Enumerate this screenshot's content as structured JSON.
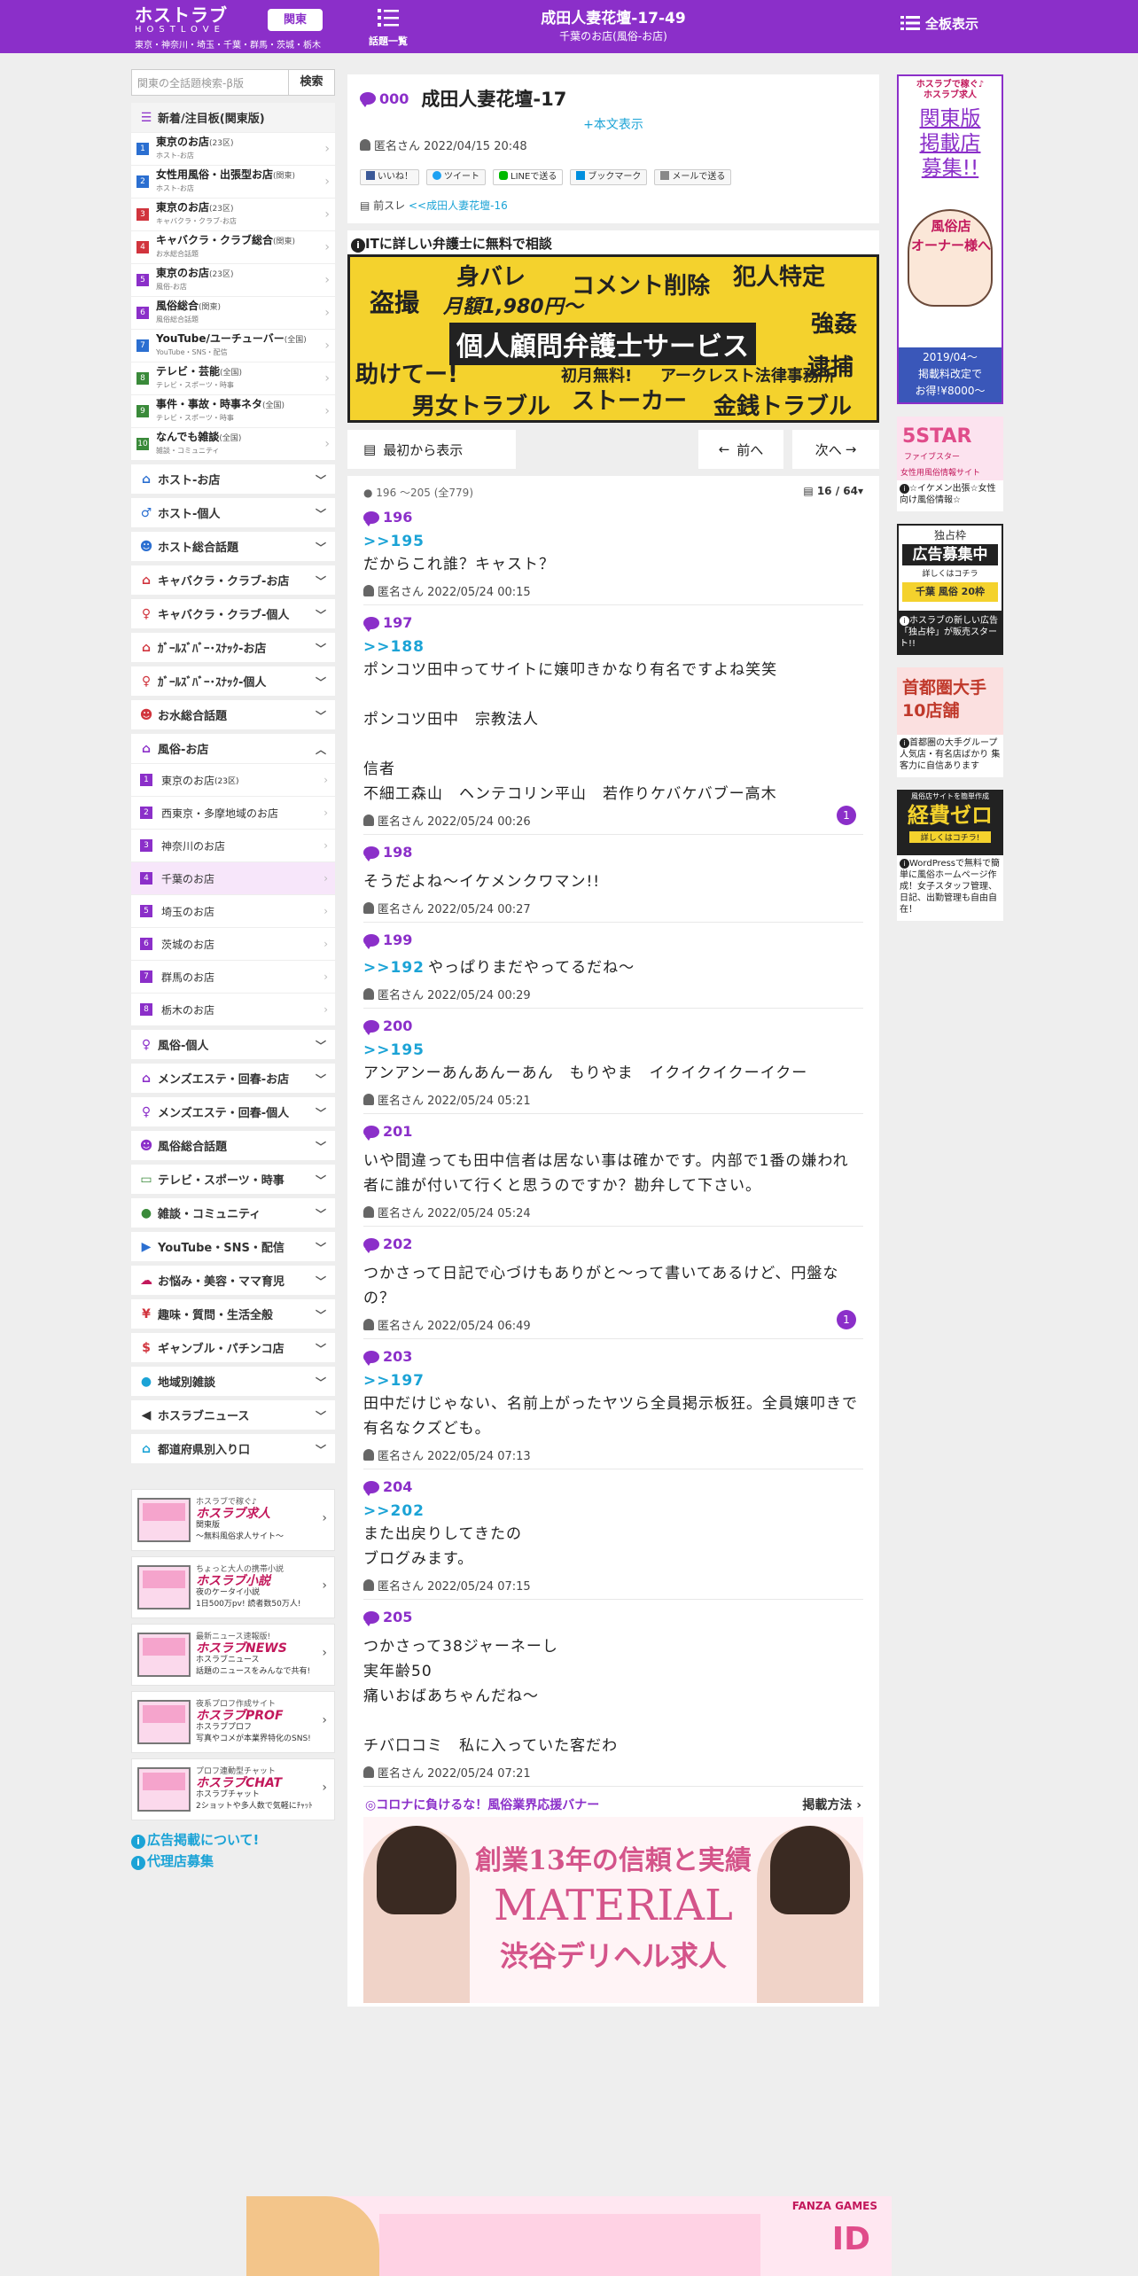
{
  "header": {
    "logo_main": "ホストラブ",
    "logo_sub": "HOSTLOVE",
    "region_button": "関東",
    "region_list": "東京・神奈川・埼玉・千葉・群馬・茨城・栃木",
    "topics_label": "話題一覧",
    "thread_title": "成田人妻花壇-17-49",
    "thread_subtitle": "千葉のお店(風俗-お店)",
    "all_boards_label": "全板表示"
  },
  "sidebar": {
    "search_placeholder": "関東の全話題検索-β版",
    "search_button": "検索",
    "new_boards_title": "新着/注目板(関東版)",
    "new_boards": [
      {
        "num": "1",
        "color": "#2b6fd1",
        "label": "東京のお店",
        "small": "(23区)",
        "sub": "ホスト-お店"
      },
      {
        "num": "2",
        "color": "#2b6fd1",
        "label": "女性用風俗・出張型お店",
        "small": "(関東)",
        "sub": "ホスト-お店"
      },
      {
        "num": "3",
        "color": "#d1343d",
        "label": "東京のお店",
        "small": "(23区)",
        "sub": "キャバクラ・クラブ-お店"
      },
      {
        "num": "4",
        "color": "#d1343d",
        "label": "キャバクラ・クラブ総合",
        "small": "(関東)",
        "sub": "お水総合話題"
      },
      {
        "num": "5",
        "color": "#8b2fc9",
        "label": "東京のお店",
        "small": "(23区)",
        "sub": "風俗-お店"
      },
      {
        "num": "6",
        "color": "#8b2fc9",
        "label": "風俗総合",
        "small": "(関東)",
        "sub": "風俗総合話題"
      },
      {
        "num": "7",
        "color": "#2b6fd1",
        "label": "YouTube/ユーチューバー",
        "small": "(全国)",
        "sub": "YouTube・SNS・配信"
      },
      {
        "num": "8",
        "color": "#3a8a3a",
        "label": "テレビ・芸能",
        "small": "(全国)",
        "sub": "テレビ・スポーツ・時事"
      },
      {
        "num": "9",
        "color": "#3a8a3a",
        "label": "事件・事故・時事ネタ",
        "small": "(全国)",
        "sub": "テレビ・スポーツ・時事"
      },
      {
        "num": "10",
        "color": "#3a8a3a",
        "label": "なんでも雑談",
        "small": "(全国)",
        "sub": "雑談・コミュニティ"
      }
    ],
    "categories_a": [
      {
        "icon": "home-icon",
        "glyph": "⌂",
        "color": "#2b6fd1",
        "label": "ホスト-お店"
      },
      {
        "icon": "person-icon",
        "glyph": "♂",
        "color": "#2b6fd1",
        "label": "ホスト-個人"
      },
      {
        "icon": "group-icon",
        "glyph": "☻",
        "color": "#2b6fd1",
        "label": "ホスト総合話題"
      },
      {
        "icon": "home-icon",
        "glyph": "⌂",
        "color": "#d1343d",
        "label": "キャバクラ・クラブ-お店"
      },
      {
        "icon": "person-icon",
        "glyph": "♀",
        "color": "#d1343d",
        "label": "キャバクラ・クラブ-個人"
      },
      {
        "icon": "home-icon",
        "glyph": "⌂",
        "color": "#d1343d",
        "label": "ｶﾞｰﾙｽﾞﾊﾞｰ･ｽﾅｯｸ-お店"
      },
      {
        "icon": "person-icon",
        "glyph": "♀",
        "color": "#d1343d",
        "label": "ｶﾞｰﾙｽﾞﾊﾞｰ･ｽﾅｯｸ-個人"
      },
      {
        "icon": "group-icon",
        "glyph": "☻",
        "color": "#d1343d",
        "label": "お水総合話題"
      }
    ],
    "fuzoku_open": {
      "label": "風俗-お店",
      "icon": "home-icon"
    },
    "fuzoku_items": [
      {
        "num": "1",
        "label": "東京のお店",
        "small": "(23区)"
      },
      {
        "num": "2",
        "label": "西東京・多摩地域のお店",
        "small": ""
      },
      {
        "num": "3",
        "label": "神奈川のお店",
        "small": ""
      },
      {
        "num": "4",
        "label": "千葉のお店",
        "small": ""
      },
      {
        "num": "5",
        "label": "埼玉のお店",
        "small": ""
      },
      {
        "num": "6",
        "label": "茨城のお店",
        "small": ""
      },
      {
        "num": "7",
        "label": "群馬のお店",
        "small": ""
      },
      {
        "num": "8",
        "label": "栃木のお店",
        "small": ""
      }
    ],
    "categories_b": [
      {
        "icon": "person-icon",
        "glyph": "♀",
        "color": "#8b2fc9",
        "label": "風俗-個人"
      },
      {
        "icon": "home-icon",
        "glyph": "⌂",
        "color": "#8b2fc9",
        "label": "メンズエステ・回春-お店"
      },
      {
        "icon": "person-icon",
        "glyph": "♀",
        "color": "#8b2fc9",
        "label": "メンズエステ・回春-個人"
      },
      {
        "icon": "group-icon",
        "glyph": "☻",
        "color": "#8b2fc9",
        "label": "風俗総合話題"
      },
      {
        "icon": "tv-icon",
        "glyph": "▭",
        "color": "#3a8a3a",
        "label": "テレビ・スポーツ・時事"
      },
      {
        "icon": "chat-icon",
        "glyph": "●",
        "color": "#3a8a3a",
        "label": "雑談・コミュニティ"
      },
      {
        "icon": "youtube-icon",
        "glyph": "▶",
        "color": "#2b6fd1",
        "label": "YouTube・SNS・配信"
      },
      {
        "icon": "cloud-icon",
        "glyph": "☁",
        "color": "#c2185b",
        "label": "お悩み・美容・ママ育児"
      },
      {
        "icon": "fork-icon",
        "glyph": "¥",
        "color": "#d1343d",
        "label": "趣味・質問・生活全般"
      },
      {
        "icon": "money-icon",
        "glyph": "$",
        "color": "#d1343d",
        "label": "ギャンブル・パチンコ店"
      },
      {
        "icon": "chat-icon",
        "glyph": "●",
        "color": "#1ba3d6",
        "label": "地域別雑談"
      },
      {
        "icon": "speaker-icon",
        "glyph": "◀",
        "color": "#333333",
        "label": "ホスラブニュース"
      },
      {
        "icon": "home-icon",
        "glyph": "⌂",
        "color": "#1ba3d6",
        "label": "都道府県別入り口"
      }
    ],
    "promo_banners": [
      {
        "small": "ホスラブで稼ぐ♪",
        "main": "ホスラブ求人",
        "note": "関東版\n〜無料風俗求人サイト〜"
      },
      {
        "small": "ちょっと大人の携帯小説",
        "main": "ホスラブ小説",
        "note": "夜のケータイ小説\n1日500万pv! 読者数50万人!"
      },
      {
        "small": "最新ニュース速報版!",
        "main": "ホスラブNEWS",
        "note": "ホスラブニュース\n話題のニュースをみんなで共有!"
      },
      {
        "small": "夜系プロフ作成サイト",
        "main": "ホスラブPROF",
        "note": "ホスラブプロフ\n写真やコメが本業界特化のSNS!"
      },
      {
        "small": "プロフ連動型チャット",
        "main": "ホスラブCHAT",
        "note": "ホスラブチャット\n2ショットや多人数で気軽にﾁｬｯﾄ"
      }
    ],
    "links": [
      "広告掲載について!",
      "代理店募集"
    ]
  },
  "thread": {
    "num": "000",
    "title": "成田人妻花壇-17",
    "show_body": "+本文表示",
    "author": "匿名さん 2022/04/15 20:48",
    "shares": [
      "いいね！",
      "ツイート",
      "LINEで送る",
      "ブックマーク",
      "メールで送る"
    ],
    "prev_label": "前スレ",
    "prev_link": "<<成田人妻花壇-16"
  },
  "ad_lawyer": {
    "header": "ITに詳しい弁護士に無料で相談",
    "words": [
      "身バレ",
      "コメント削除",
      "犯人特定",
      "盗撮",
      "月額1,980円〜",
      "強姦",
      "個人顧問弁護士サービス",
      "助けてー!",
      "初月無料!",
      "アークレスト法律事務所",
      "逮捕",
      "男女トラブル",
      "ストーカー",
      "金銭トラブル"
    ]
  },
  "nav": {
    "first": "最初から表示",
    "prev": "前へ",
    "next": "次へ"
  },
  "posts_header": {
    "range": "196 ～205 (全779)",
    "page": "16 / 64"
  },
  "posts": [
    {
      "num": "196",
      "reply": ">>195",
      "body": "だからこれ誰？キャスト？",
      "meta": "匿名さん 2022/05/24 00:15",
      "count": ""
    },
    {
      "num": "197",
      "reply": ">>188",
      "body": "ポンコツ田中ってサイトに嬢叩きかなり有名ですよね笑笑\n\nポンコツ田中　宗教法人\n\n信者\n不細工森山　ヘンテコリン平山　若作りケバケバブー高木",
      "meta": "匿名さん 2022/05/24 00:26",
      "count": "1"
    },
    {
      "num": "198",
      "reply": "",
      "body": "そうだよね～イケメンクワマン!!",
      "meta": "匿名さん 2022/05/24 00:27",
      "count": ""
    },
    {
      "num": "199",
      "reply": ">>192",
      "body": "やっぱりまだやってるだね～",
      "meta": "匿名さん 2022/05/24 00:29",
      "count": ""
    },
    {
      "num": "200",
      "reply": ">>195",
      "body": "アンアンーあんあんーあん　もりやま　イクイクイクーイクー",
      "meta": "匿名さん 2022/05/24 05:21",
      "count": ""
    },
    {
      "num": "201",
      "reply": "",
      "body": "いや間違っても田中信者は居ない事は確かです。内部で1番の嫌われ者に誰が付いて行くと思うのですか？勘弁して下さい。",
      "meta": "匿名さん 2022/05/24 05:24",
      "count": ""
    },
    {
      "num": "202",
      "reply": "",
      "body": "つかさって日記で心づけもありがと〜って書いてあるけど、円盤なの？",
      "meta": "匿名さん 2022/05/24 06:49",
      "count": "1"
    },
    {
      "num": "203",
      "reply": ">>197",
      "body": "田中だけじゃない、名前上がったヤツら全員掲示板狂。全員嬢叩きで有名なクズども。",
      "meta": "匿名さん 2022/05/24 07:13",
      "count": ""
    },
    {
      "num": "204",
      "reply": ">>202",
      "body": "また出戻りしてきたの\nブログみます。",
      "meta": "匿名さん 2022/05/24 07:15",
      "count": ""
    },
    {
      "num": "205",
      "reply": "",
      "body": "つかさって38ジャーネーし\n実年齢50\n痛いおばあちゃんだね～\n\nチバ口コミ　私に入っていた客だわ",
      "meta": "匿名さん 2022/05/24 07:21",
      "count": ""
    }
  ],
  "support": {
    "title": "◎コロナに負けるな！風俗業界応援バナー",
    "link": "掲載方法 ›",
    "banner_line1": "創業13年の信頼と実績",
    "banner_line2": "MATERIAL",
    "banner_line3": "渋谷デリヘル求人"
  },
  "right_ads": [
    {
      "title": "関東版\n掲載店\n募集!!",
      "top": "ホスラブで稼ぐ♪\nホスラブ求人",
      "mid": "風俗店\nオーナー様へ",
      "price": "2019/04〜\n掲載料改定で\nお得!¥8000〜",
      "cap": ""
    },
    {
      "title": "5STAR",
      "top": "ファイブスター",
      "mid": "女性用風俗情報サイト",
      "price": "",
      "cap": "☆イケメン出張☆女性向け風俗情報☆"
    },
    {
      "title": "広告募集中",
      "top": "独占枠",
      "mid": "詳しくはコチラ",
      "price": "千葉 風俗 20枠",
      "cap": "ホスラブの新しい広告「独占枠」が販売スタート!!"
    },
    {
      "title": "首都圏大手\n10店舗",
      "top": "",
      "mid": "",
      "price": "",
      "cap": "首都圏の大手グループ 人気店・有名店ばかり 集客力に自信あります"
    },
    {
      "title": "経費ゼロ",
      "top": "風俗店サイトを簡単作成",
      "mid": "詳しくはコチラ!",
      "price": "",
      "cap": "WordPressで無料で簡単に風俗ホームページ作成！女子スタッフ管理、日記、出勤管理も自由自在！"
    }
  ],
  "bottom_ad": {
    "brand": "FANZA GAMES",
    "title": "ID"
  },
  "colors": {
    "brand": "#8b2fc9",
    "link": "#1ba3d6",
    "bg": "#eeeeee"
  }
}
